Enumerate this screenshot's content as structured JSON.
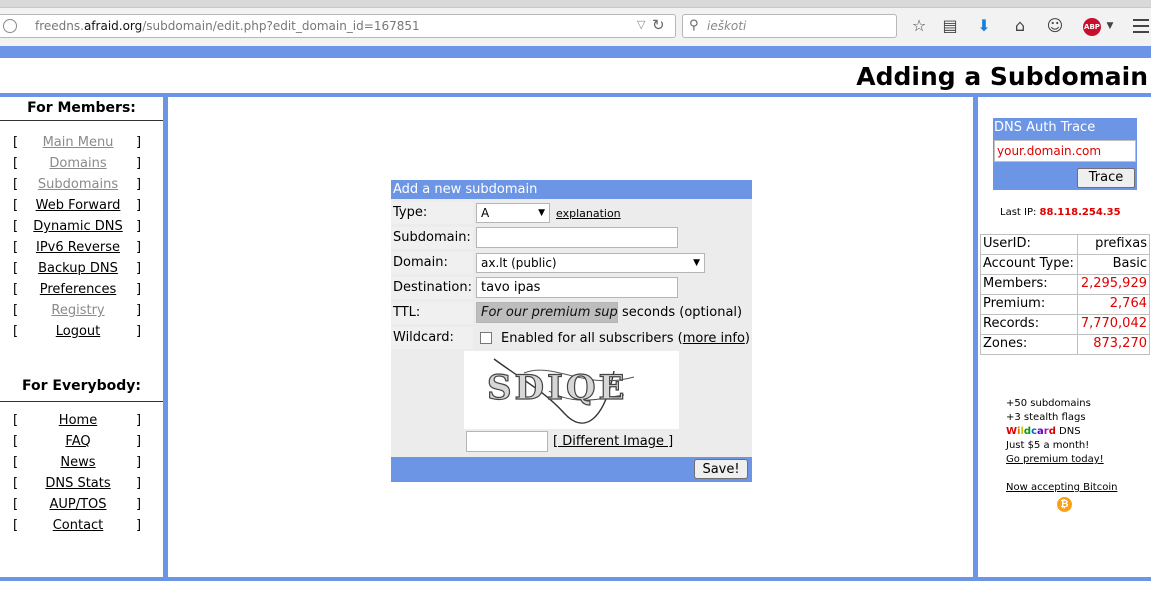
{
  "browser": {
    "url_prefix": "freedns.",
    "url_domain": "afraid.org",
    "url_path": "/subdomain/edit.php?edit_domain_id=167851",
    "search_placeholder": "ieškoti",
    "abp_label": "ABP",
    "icons": [
      "globe-icon",
      "dropdown-arrow-icon",
      "reload-icon",
      "search-icon",
      "star-icon",
      "reading-list-icon",
      "download-icon",
      "home-icon",
      "chat-icon",
      "adblock-icon",
      "menu-icon"
    ]
  },
  "header": {
    "title": "Adding a Subdomain"
  },
  "leftnav": {
    "members_heading": "For Members:",
    "members_items": [
      {
        "label": "Main Menu",
        "dim": true
      },
      {
        "label": "Domains",
        "dim": true
      },
      {
        "label": "Subdomains",
        "dim": true
      },
      {
        "label": "Web Forward",
        "dim": false
      },
      {
        "label": "Dynamic DNS",
        "dim": false
      },
      {
        "label": "IPv6 Reverse",
        "dim": false
      },
      {
        "label": "Backup DNS",
        "dim": false
      },
      {
        "label": "Preferences",
        "dim": false
      },
      {
        "label": "Registry",
        "dim": true
      },
      {
        "label": "Logout",
        "dim": false
      }
    ],
    "everybody_heading": "For Everybody:",
    "everybody_items": [
      {
        "label": "Home"
      },
      {
        "label": "FAQ"
      },
      {
        "label": "News"
      },
      {
        "label": "DNS Stats"
      },
      {
        "label": "AUP/TOS"
      },
      {
        "label": "Contact"
      }
    ],
    "bracket_open": "[",
    "bracket_close": "]"
  },
  "form": {
    "heading": "Add a new subdomain",
    "type_label": "Type:",
    "type_value": "A",
    "explanation_link": "explanation",
    "subdomain_label": "Subdomain:",
    "subdomain_value": "",
    "domain_label": "Domain:",
    "domain_value": "ax.lt (public)",
    "destination_label": "Destination:",
    "destination_value": "tavo ipas",
    "ttl_label": "TTL:",
    "ttl_value": "For our premium supporters",
    "ttl_suffix": "seconds (optional)",
    "wildcard_label": "Wildcard:",
    "wildcard_checked": false,
    "wildcard_text": "Enabled for all subscribers (",
    "more_info_link": "more info",
    "wildcard_close": ")",
    "captcha_text": "SDIQE",
    "captcha_input_value": "",
    "different_image_link": "[ Different Image ]",
    "save_button": "Save!"
  },
  "right": {
    "trace_heading": "DNS Auth Trace",
    "trace_input_value": "your.domain.com",
    "trace_button": "Trace",
    "last_ip_label": "Last IP:",
    "last_ip_value": "88.118.254.35",
    "stats": [
      {
        "label": "UserID:",
        "value": "prefixas",
        "red": false
      },
      {
        "label": "Account Type:",
        "value": "Basic",
        "red": false
      },
      {
        "label": "Members:",
        "value": "2,295,929",
        "red": true
      },
      {
        "label": "Premium:",
        "value": "2,764",
        "red": true
      },
      {
        "label": "Records:",
        "value": "7,770,042",
        "red": true
      },
      {
        "label": "Zones:",
        "value": "873,270",
        "red": true
      }
    ],
    "promo_line1": "+50 subdomains",
    "promo_line2": "+3 stealth flags",
    "promo_wildcard": "Wildcard",
    "promo_dns": " DNS",
    "promo_line4": "Just $5 a month!",
    "promo_link": "Go premium today!",
    "bitcoin_link": "Now accepting Bitcoin",
    "bitcoin_symbol": "₿",
    "wildcard_colors": [
      "#e00000",
      "#e07000",
      "#c8c800",
      "#00a000",
      "#0060e0",
      "#6000c0",
      "#c000c0",
      "#e00000"
    ]
  }
}
